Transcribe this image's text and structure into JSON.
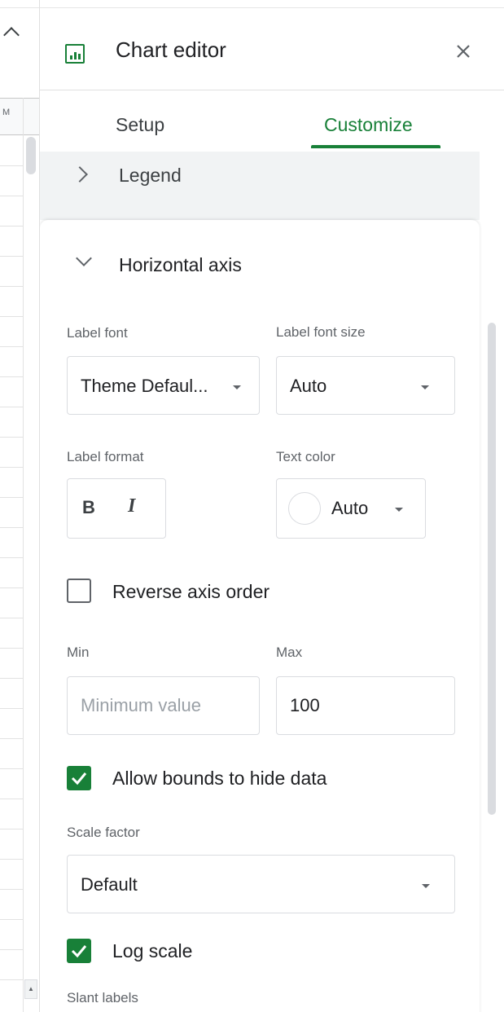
{
  "sheet": {
    "column_letter": "M",
    "scroll_up_glyph": "▲"
  },
  "editor": {
    "title": "Chart editor",
    "close_glyph": "×",
    "tabs": [
      {
        "label": "Setup",
        "active": false
      },
      {
        "label": "Customize",
        "active": true
      }
    ],
    "sections": {
      "legend": {
        "label": "Legend",
        "expanded": false
      },
      "horizontal_axis": {
        "label": "Horizontal axis",
        "expanded": true,
        "label_font": {
          "label": "Label font",
          "value": "Theme Defaul..."
        },
        "label_font_size": {
          "label": "Label font size",
          "value": "Auto"
        },
        "label_format": {
          "label": "Label format",
          "bold": "B",
          "italic": "I"
        },
        "text_color": {
          "label": "Text color",
          "value": "Auto"
        },
        "reverse_axis_order": {
          "label": "Reverse axis order",
          "checked": false
        },
        "min": {
          "label": "Min",
          "placeholder": "Minimum value",
          "value": ""
        },
        "max": {
          "label": "Max",
          "value": "100"
        },
        "allow_bounds": {
          "label": "Allow bounds to hide data",
          "checked": true
        },
        "scale_factor": {
          "label": "Scale factor",
          "value": "Default"
        },
        "log_scale": {
          "label": "Log scale",
          "checked": true
        },
        "slant_labels": {
          "label": "Slant labels"
        }
      }
    }
  },
  "colors": {
    "accent": "#188038",
    "text": "#202124",
    "secondary_text": "#5f6368",
    "border": "#dadce0",
    "section_bg": "#f1f3f4"
  },
  "icons": {
    "chart": "chart-icon",
    "close": "close-icon",
    "collapse_chevron": "chevron-right-icon",
    "expand_chevron": "chevron-down-icon",
    "dropdown": "caret-down-icon",
    "check": "check-icon"
  }
}
